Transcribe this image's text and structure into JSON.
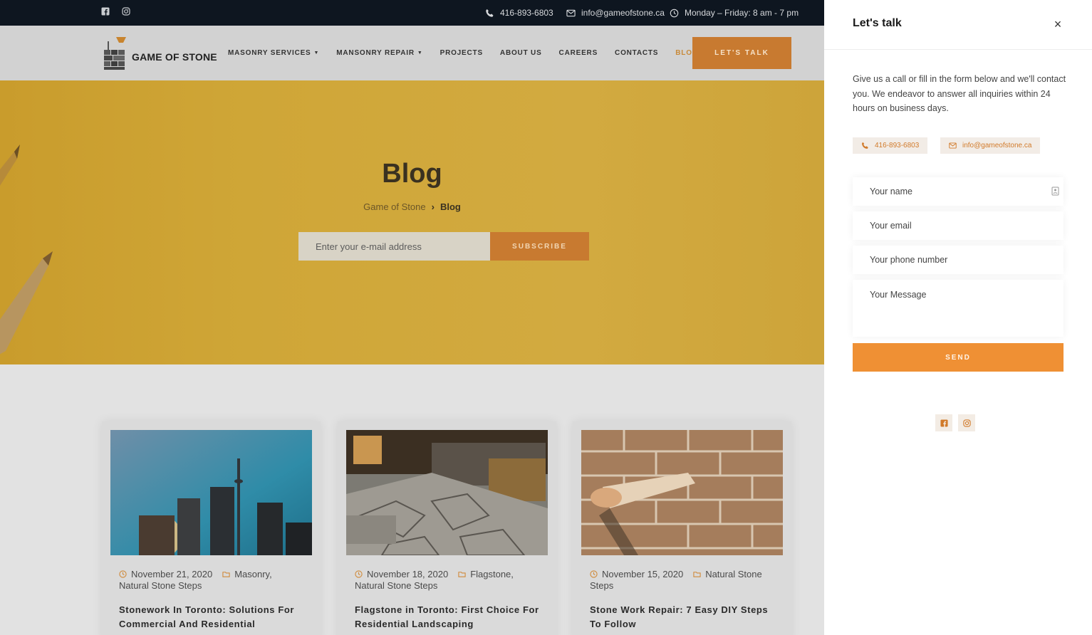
{
  "topbar": {
    "phone": "416-893-6803",
    "email": "info@gameofstone.ca",
    "hours": "Monday – Friday: 8 am - 7 pm",
    "icons": [
      "facebook-icon",
      "instagram-icon",
      "phone-icon",
      "mail-icon",
      "clock-icon"
    ]
  },
  "header": {
    "logo_text": "GAME OF STONE",
    "nav": [
      {
        "label": "MASONRY SERVICES",
        "dropdown": true
      },
      {
        "label": "MANSONRY REPAIR",
        "dropdown": true
      },
      {
        "label": "PROJECTS"
      },
      {
        "label": "ABOUT US"
      },
      {
        "label": "CAREERS"
      },
      {
        "label": "CONTACTS"
      },
      {
        "label": "BLOG",
        "active": true
      }
    ],
    "cta_label": "LET'S TALK"
  },
  "hero": {
    "title": "Blog",
    "breadcrumb_home": "Game of Stone",
    "breadcrumb_sep": "›",
    "breadcrumb_current": "Blog",
    "subscribe_placeholder": "Enter your e-mail address",
    "subscribe_label": "SUBSCRIBE"
  },
  "posts": [
    {
      "date": "November 21, 2020",
      "category_1": "Masonry,",
      "category_2": "Natural Stone Steps",
      "title": "Stonework In Toronto: Solutions For Commercial And Residential"
    },
    {
      "date": "November 18, 2020",
      "category_1": "Flagstone,",
      "category_2": "Natural Stone Steps",
      "title": "Flagstone in Toronto: First Choice For Residential Landscaping"
    },
    {
      "date": "November 15, 2020",
      "category_1": "Natural Stone",
      "category_2": "Steps",
      "title": "Stone Work Repair: 7 Easy DIY Steps To Follow"
    }
  ],
  "panel": {
    "title": "Let's talk",
    "description": "Give us a call or fill in the form below and we'll contact you. We endeavor to answer all inquiries within 24 hours on business days.",
    "phone": "416-893-6803",
    "email": "info@gameofstone.ca",
    "name_placeholder": "Your name",
    "email_placeholder": "Your email",
    "phone_placeholder": "Your phone number",
    "message_placeholder": "Your Message",
    "send_label": "SEND"
  },
  "colors": {
    "accent": "#ef9034",
    "hero": "#cfa637",
    "topbar": "#0e1620"
  }
}
